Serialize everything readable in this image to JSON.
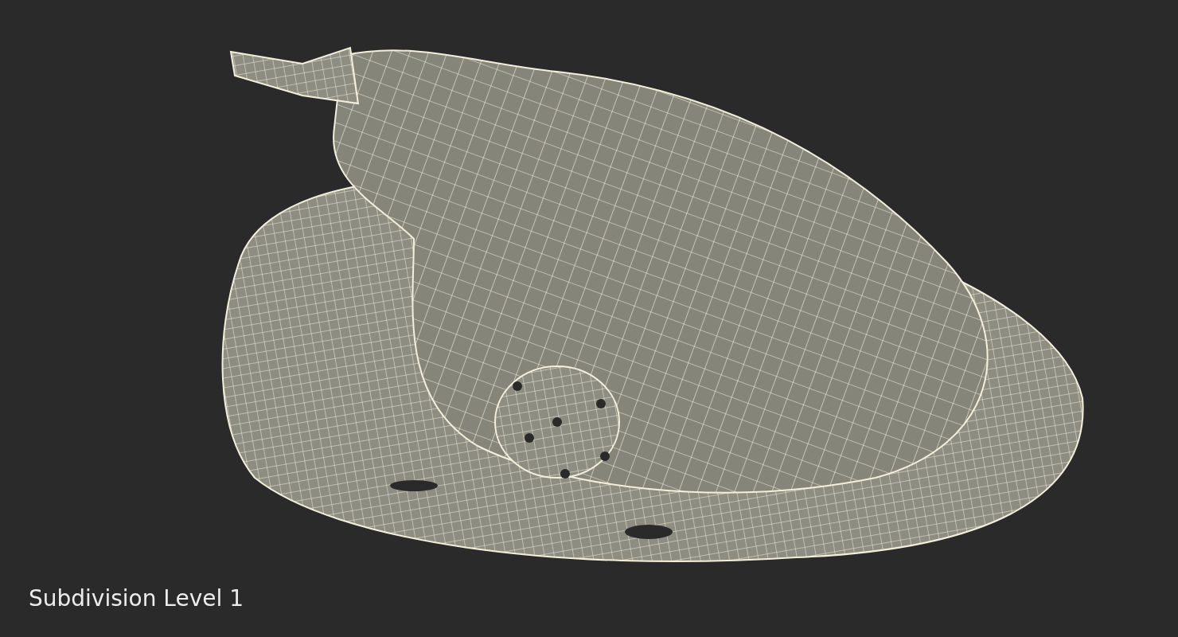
{
  "caption": "Subdivision Level 1"
}
